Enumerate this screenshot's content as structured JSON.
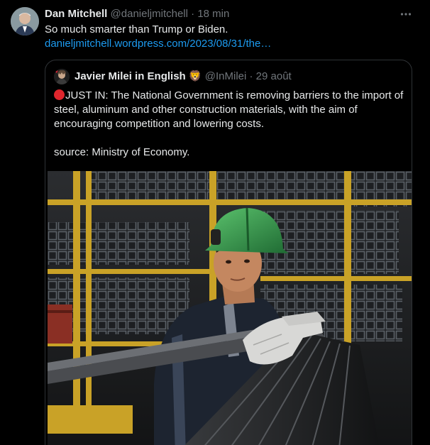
{
  "tweet": {
    "author_name": "Dan Mitchell",
    "author_handle": "@danieljmitchell",
    "separator": "·",
    "time": "18 min",
    "text": "So much smarter than Trump or Biden.",
    "link": "danieljmitchell.wordpress.com/2023/08/31/the…",
    "more_icon": "more-horizontal-icon"
  },
  "quoted": {
    "author_name": "Javier Milei in English",
    "badge_emoji": "🦁",
    "author_handle": "@InMilei",
    "separator": "·",
    "time": "29 août",
    "line1": "JUST IN: The National Government is removing barriers to the import of steel, aluminum and other construction materials, with the aim of encouraging competition and lowering costs.",
    "line2": "source: Ministry of Economy.",
    "status_icon": "red-circle-icon",
    "status_color": "#e0262d"
  },
  "colors": {
    "background": "#000000",
    "text": "#e7e9ea",
    "muted": "#71767b",
    "link": "#1d9bf0",
    "border": "#2f3336",
    "helmet": "#2e8b45",
    "rack_yellow": "#c9a227"
  }
}
